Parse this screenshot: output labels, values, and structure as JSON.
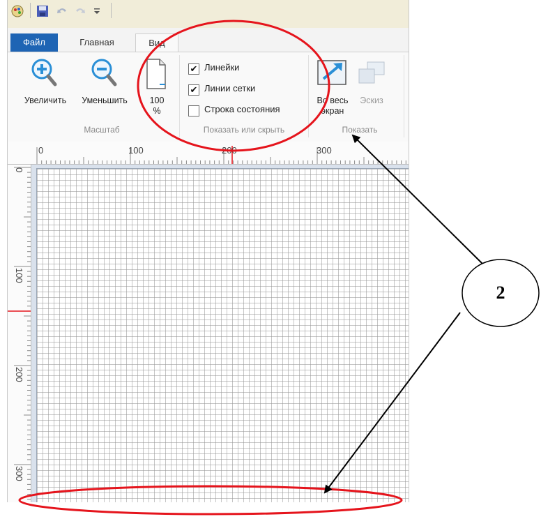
{
  "tabs": {
    "file": "Файл",
    "home": "Главная",
    "view": "Вид"
  },
  "zoom_group": {
    "zoom_in": "Увеличить",
    "zoom_out": "Уменьшить",
    "hundred_top": "100",
    "hundred_bottom": "%",
    "label": "Масштаб"
  },
  "show_hide_group": {
    "rulers": {
      "label": "Линейки",
      "checked": true
    },
    "gridlines": {
      "label": "Линии сетки",
      "checked": true
    },
    "status_bar": {
      "label": "Строка состояния",
      "checked": false
    },
    "label": "Показать или скрыть"
  },
  "display_group": {
    "fullscreen_top": "Во весь",
    "fullscreen_bottom": "экран",
    "thumbnail": "Эскиз",
    "label": "Показать"
  },
  "rulers": {
    "horizontal": [
      "0",
      "100",
      "200",
      "300"
    ],
    "vertical": [
      "0",
      "100",
      "200",
      "300"
    ]
  },
  "callout": {
    "number": "2"
  },
  "colors": {
    "file_tab": "#1e64b4",
    "annotation_red": "#e5141c",
    "icon_blue": "#2a8fd6"
  }
}
